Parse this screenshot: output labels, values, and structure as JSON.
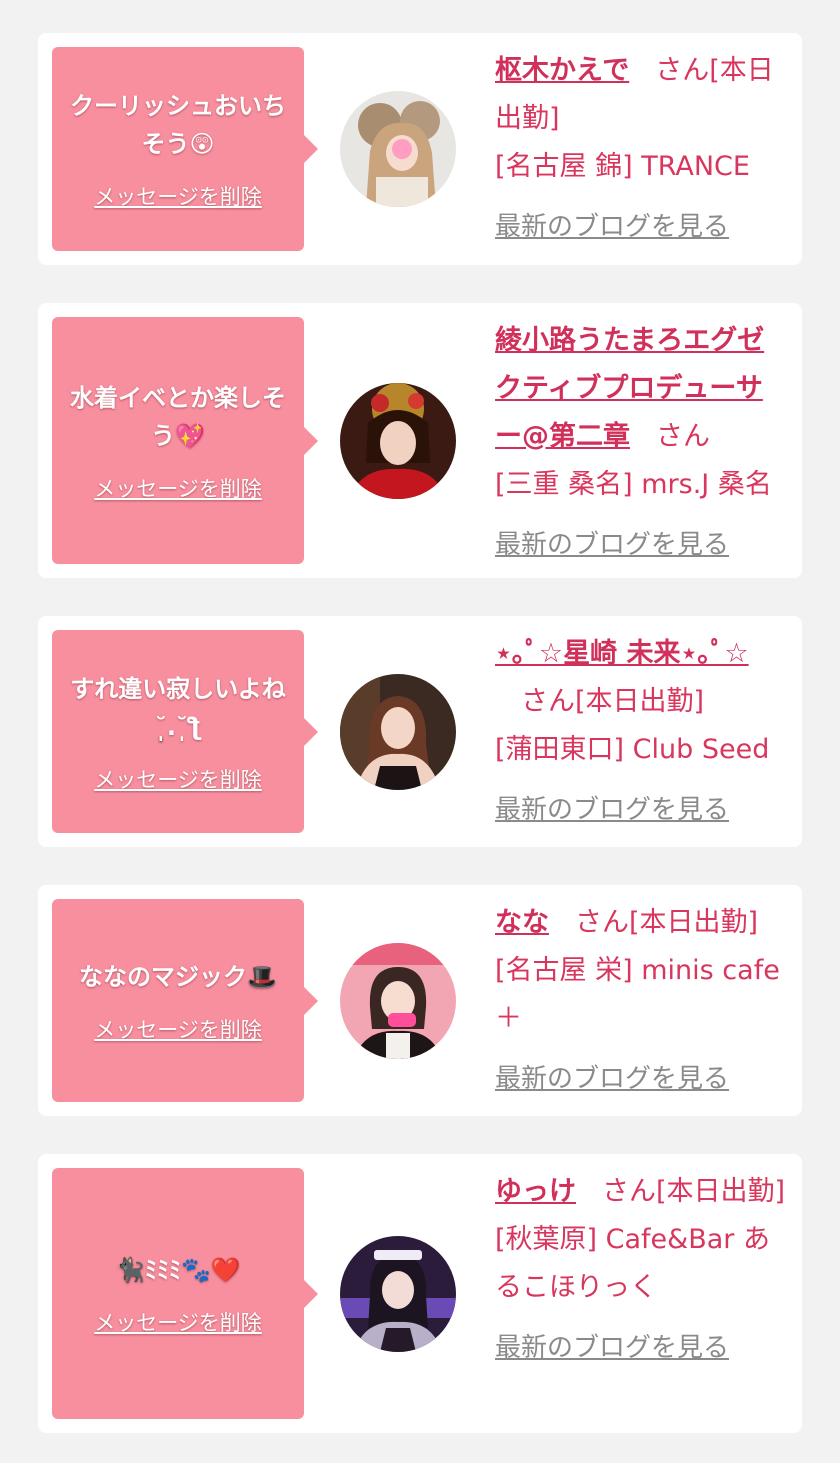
{
  "cards": [
    {
      "message": "クーリッシュおいちそう😲",
      "delete_label": "メッセージを削除",
      "name": "枢木かえで",
      "suffix": "さん[本日出勤]",
      "shop": "[名古屋 錦] TRANCE",
      "blog_label": "最新のブログを見る"
    },
    {
      "message": "水着イベとか楽しそう💖",
      "delete_label": "メッセージを削除",
      "name": "綾小路うたまろエグゼクティブプロデューサー@第二章",
      "suffix": "さん",
      "shop": "[三重 桑名] mrs.J 桑名",
      "blog_label": "最新のブログを見る"
    },
    {
      "message": "すれ違い寂しいよね ˘̩̩̩.˘̩ƪ",
      "delete_label": "メッセージを削除",
      "name": "⋆｡ﾟ☆星崎 未来⋆｡ﾟ☆",
      "suffix": "さん[本日出勤]",
      "shop": "[蒲田東口] Club Seed",
      "blog_label": "最新のブログを見る"
    },
    {
      "message": "ななのマジック🎩",
      "delete_label": "メッセージを削除",
      "name": "なな",
      "suffix": "さん[本日出勤]",
      "shop": "[名古屋 栄] minis cafe＋",
      "blog_label": "最新のブログを見る"
    },
    {
      "message": "🐈‍⬛ﾐﾐﾐ🐾❤️",
      "delete_label": "メッセージを削除",
      "name": "ゆっけ",
      "suffix": "さん[本日出勤]",
      "shop": "[秋葉原] Cafe&Bar あるこほりっく",
      "blog_label": "最新のブログを見る"
    }
  ]
}
